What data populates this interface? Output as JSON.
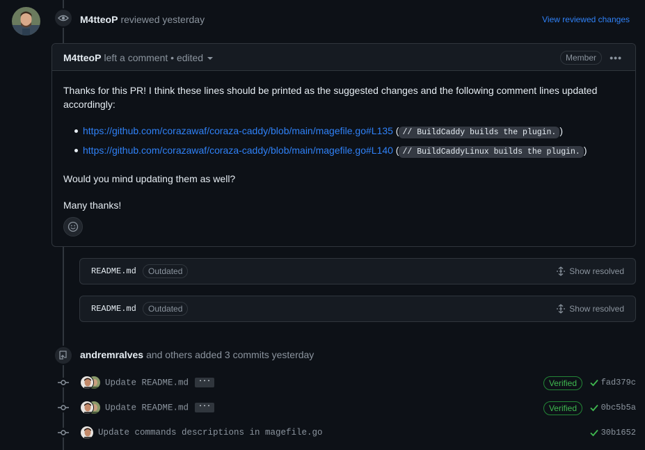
{
  "review": {
    "author": "M4tteoP",
    "action": "reviewed yesterday",
    "view_changes_label": "View reviewed changes"
  },
  "comment": {
    "author": "M4tteoP",
    "meta": "left a comment • edited",
    "role_badge": "Member",
    "intro": "Thanks for this PR! I think these lines should be printed as the suggested changes and the following comment lines updated accordingly:",
    "links": [
      {
        "url": "https://github.com/corazawaf/coraza-caddy/blob/main/magefile.go#L135",
        "code": "// BuildCaddy builds the plugin."
      },
      {
        "url": "https://github.com/corazawaf/coraza-caddy/blob/main/magefile.go#L140",
        "code": "// BuildCaddyLinux builds the plugin."
      }
    ],
    "question": "Would you mind updating them as well?",
    "thanks": "Many thanks!"
  },
  "files": [
    {
      "name": "README.md",
      "badge": "Outdated",
      "action": "Show resolved"
    },
    {
      "name": "README.md",
      "badge": "Outdated",
      "action": "Show resolved"
    }
  ],
  "commits_header": {
    "author": "andremralves",
    "text": "and others added 3 commits yesterday"
  },
  "commits": [
    {
      "message": "Update README.md",
      "verified": "Verified",
      "sha": "fad379c",
      "ellipsis": "···"
    },
    {
      "message": "Update README.md",
      "verified": "Verified",
      "sha": "0bc5b5a",
      "ellipsis": "···"
    },
    {
      "message": "Update commands descriptions in magefile.go",
      "sha": "30b1652"
    }
  ],
  "colors": {
    "link": "#2f81f7",
    "success": "#3fb950",
    "border": "#30363d",
    "background": "#0d1117"
  }
}
